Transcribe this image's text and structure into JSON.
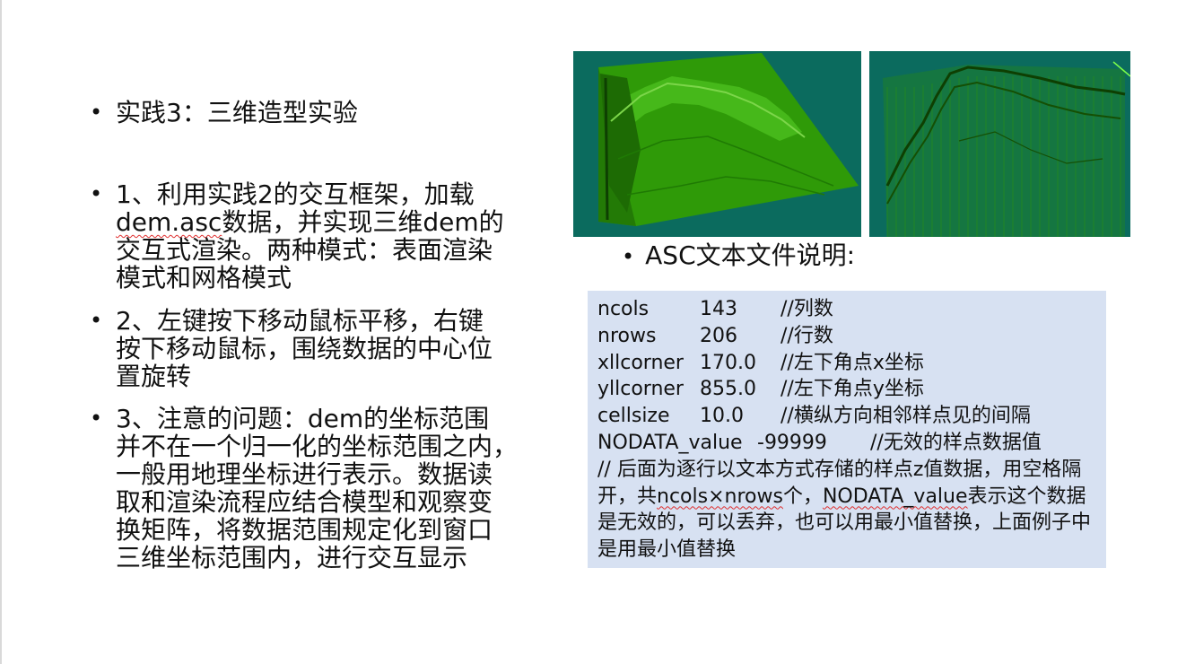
{
  "slide": {
    "bullets": [
      {
        "marker": "•",
        "text": "实践3：三维造型实验"
      },
      {
        "marker": "•",
        "parts": [
          "1、利用实践2的交互框架，加载\n",
          "dem.asc",
          "数据，并实现三维dem的\n交互式渲染。两种模式：表面渲染\n模式和网格模式"
        ]
      },
      {
        "marker": "•",
        "text": "2、左键按下移动鼠标平移，右键\n按下移动鼠标，围绕数据的中心位\n置旋转"
      },
      {
        "marker": "•",
        "text": "3、注意的问题：dem的坐标范围\n并不在一个归一化的坐标范围之内，\n一般用地理坐标进行表示。数据读\n取和渲染流程应结合模型和观察变\n换矩阵，将数据范围规定化到窗口\n三维坐标范围内，进行交互显示"
      }
    ],
    "asc_heading": {
      "marker": "•",
      "text": "ASC文本文件说明:"
    },
    "asc_fields": [
      {
        "key": "ncols",
        "value": "143",
        "comment": "//列数"
      },
      {
        "key": "nrows",
        "value": "206",
        "comment": "//行数"
      },
      {
        "key": "xllcorner",
        "value": "170.0",
        "comment": "//左下角点x坐标"
      },
      {
        "key": "yllcorner",
        "value": "855.0",
        "comment": "//左下角点y坐标"
      },
      {
        "key": "cellsize",
        "value": "10.0",
        "comment": "//横纵方向相邻样点见的间隔"
      }
    ],
    "nodata_line": {
      "key": "NODATA_value",
      "value": "-99999",
      "comment": "//无效的样点数据值"
    },
    "note_parts": [
      "// 后面为逐行以文本方式存储的样点z值数据，用空格隔开，共",
      "ncols×nrows",
      "个，",
      "NODATA_value",
      "表示这个数据是无效的，可以丢弃，也可以用最小值替换，上面例子中是用最小值替换"
    ],
    "colors": {
      "background": "#ffffff",
      "code_box": "#d7e1f2",
      "render_bg": "#0b6b5e",
      "terrain": "#2f9a08",
      "spellcheck": "#e03030"
    },
    "images": [
      {
        "name": "surface-render-image",
        "mode": "surface"
      },
      {
        "name": "mesh-render-image",
        "mode": "mesh"
      }
    ]
  }
}
